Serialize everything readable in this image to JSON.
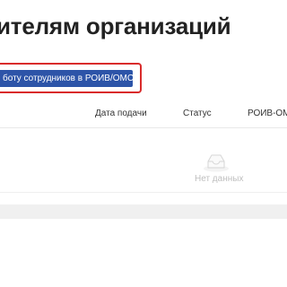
{
  "header": {
    "title": "ителям организаций"
  },
  "toolbar": {
    "action_label": "боту сотрудников в РОИВ/ОМСУ"
  },
  "table": {
    "columns": [
      "",
      "Дата подачи",
      "Статус",
      "РОИВ-ОМС"
    ],
    "empty_text": "Нет данных"
  },
  "colors": {
    "button_bg": "#2d54a8",
    "highlight_border": "#d92b2b",
    "band_bg": "#f0f0f0"
  },
  "icons": {
    "empty_state": "empty-inbox-icon"
  }
}
